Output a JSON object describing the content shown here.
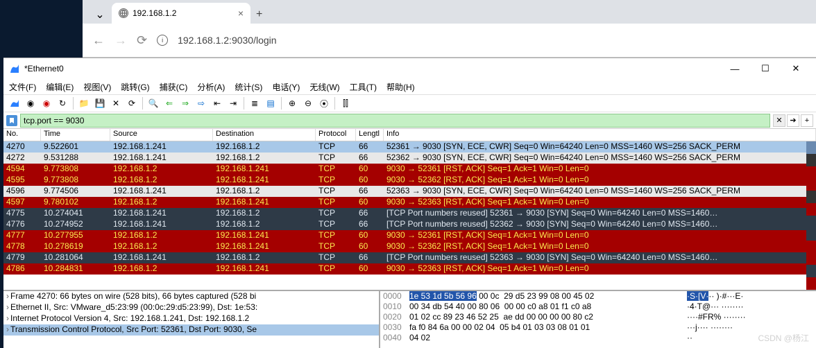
{
  "browser": {
    "tab_title": "192.168.1.2",
    "url": "192.168.1.2:9030/login",
    "close": "×",
    "plus": "+"
  },
  "ws": {
    "title": "*Ethernet0",
    "min": "—",
    "max": "☐",
    "close": "✕",
    "menu": [
      "文件(F)",
      "编辑(E)",
      "视图(V)",
      "跳转(G)",
      "捕获(C)",
      "分析(A)",
      "统计(S)",
      "电话(Y)",
      "无线(W)",
      "工具(T)",
      "帮助(H)"
    ],
    "filter_value": "tcp.port == 9030",
    "filter_clear": "✕",
    "filter_go": "➔",
    "filter_plus": "+",
    "headers": [
      "No.",
      "Time",
      "Source",
      "Destination",
      "Protocol",
      "Lengtl",
      "Info"
    ],
    "rows": [
      {
        "cls": "sel",
        "no": "4270",
        "time": "9.522601",
        "src": "192.168.1.241",
        "dst": "192.168.1.2",
        "pro": "TCP",
        "len": "66",
        "info": "52361 → 9030 [SYN, ECE, CWR] Seq=0 Win=64240 Len=0 MSS=1460 WS=256 SACK_PERM"
      },
      {
        "cls": "norm",
        "no": "4272",
        "time": "9.531288",
        "src": "192.168.1.241",
        "dst": "192.168.1.2",
        "pro": "TCP",
        "len": "66",
        "info": "52362 → 9030 [SYN, ECE, CWR] Seq=0 Win=64240 Len=0 MSS=1460 WS=256 SACK_PERM"
      },
      {
        "cls": "rst",
        "no": "4594",
        "time": "9.773808",
        "src": "192.168.1.2",
        "dst": "192.168.1.241",
        "pro": "TCP",
        "len": "60",
        "info": "9030 → 52361 [RST, ACK] Seq=1 Ack=1 Win=0 Len=0"
      },
      {
        "cls": "rst",
        "no": "4595",
        "time": "9.773808",
        "src": "192.168.1.2",
        "dst": "192.168.1.241",
        "pro": "TCP",
        "len": "60",
        "info": "9030 → 52362 [RST, ACK] Seq=1 Ack=1 Win=0 Len=0"
      },
      {
        "cls": "norm",
        "no": "4596",
        "time": "9.774506",
        "src": "192.168.1.241",
        "dst": "192.168.1.2",
        "pro": "TCP",
        "len": "66",
        "info": "52363 → 9030 [SYN, ECE, CWR] Seq=0 Win=64240 Len=0 MSS=1460 WS=256 SACK_PERM"
      },
      {
        "cls": "rst",
        "no": "4597",
        "time": "9.780102",
        "src": "192.168.1.2",
        "dst": "192.168.1.241",
        "pro": "TCP",
        "len": "60",
        "info": "9030 → 52363 [RST, ACK] Seq=1 Ack=1 Win=0 Len=0"
      },
      {
        "cls": "syn2",
        "no": "4775",
        "time": "10.274041",
        "src": "192.168.1.241",
        "dst": "192.168.1.2",
        "pro": "TCP",
        "len": "66",
        "info": "[TCP Port numbers reused] 52361 → 9030 [SYN] Seq=0 Win=64240 Len=0 MSS=1460…"
      },
      {
        "cls": "syn2",
        "no": "4776",
        "time": "10.274952",
        "src": "192.168.1.241",
        "dst": "192.168.1.2",
        "pro": "TCP",
        "len": "66",
        "info": "[TCP Port numbers reused] 52362 → 9030 [SYN] Seq=0 Win=64240 Len=0 MSS=1460…"
      },
      {
        "cls": "rst",
        "no": "4777",
        "time": "10.277955",
        "src": "192.168.1.2",
        "dst": "192.168.1.241",
        "pro": "TCP",
        "len": "60",
        "info": "9030 → 52361 [RST, ACK] Seq=1 Ack=1 Win=0 Len=0"
      },
      {
        "cls": "rst",
        "no": "4778",
        "time": "10.278619",
        "src": "192.168.1.2",
        "dst": "192.168.1.241",
        "pro": "TCP",
        "len": "60",
        "info": "9030 → 52362 [RST, ACK] Seq=1 Ack=1 Win=0 Len=0"
      },
      {
        "cls": "syn2",
        "no": "4779",
        "time": "10.281064",
        "src": "192.168.1.241",
        "dst": "192.168.1.2",
        "pro": "TCP",
        "len": "66",
        "info": "[TCP Port numbers reused] 52363 → 9030 [SYN] Seq=0 Win=64240 Len=0 MSS=1460…"
      },
      {
        "cls": "rst",
        "no": "4786",
        "time": "10.284831",
        "src": "192.168.1.2",
        "dst": "192.168.1.241",
        "pro": "TCP",
        "len": "60",
        "info": "9030 → 52363 [RST, ACK] Seq=1 Ack=1 Win=0 Len=0"
      }
    ],
    "tree": [
      {
        "sel": false,
        "t": "Frame 4270: 66 bytes on wire (528 bits), 66 bytes captured (528 bi"
      },
      {
        "sel": false,
        "t": "Ethernet II, Src: VMware_d5:23:99 (00:0c:29:d5:23:99), Dst: 1e:53:"
      },
      {
        "sel": false,
        "t": "Internet Protocol Version 4, Src: 192.168.1.241, Dst: 192.168.1.2"
      },
      {
        "sel": true,
        "t": "Transmission Control Protocol, Src Port: 52361, Dst Port: 9030, Se"
      }
    ],
    "hex": [
      {
        "off": "0000",
        "b": "1e 53 1d 5b 56 96",
        "b2": " 00 0c  29 d5 23 99 08 00 45 02",
        "a": "·S·[V·",
        "a2": "·· )·#···E·"
      },
      {
        "off": "0010",
        "b": "",
        "b2": "00 34 db 54 40 00 80 06  00 00 c0 a8 01 f1 c0 a8",
        "a": "",
        "a2": "·4·T@··· ········"
      },
      {
        "off": "0020",
        "b": "",
        "b2": "01 02 cc 89 23 46 52 25  ae dd 00 00 00 00 80 c2",
        "a": "",
        "a2": "····#FR% ········"
      },
      {
        "off": "0030",
        "b": "",
        "b2": "fa f0 84 6a 00 00 02 04  05 b4 01 03 03 08 01 01",
        "a": "",
        "a2": "···j···· ········"
      },
      {
        "off": "0040",
        "b": "",
        "b2": "04 02",
        "a": "",
        "a2": "··"
      }
    ]
  },
  "watermark": "CSDN @杨江"
}
